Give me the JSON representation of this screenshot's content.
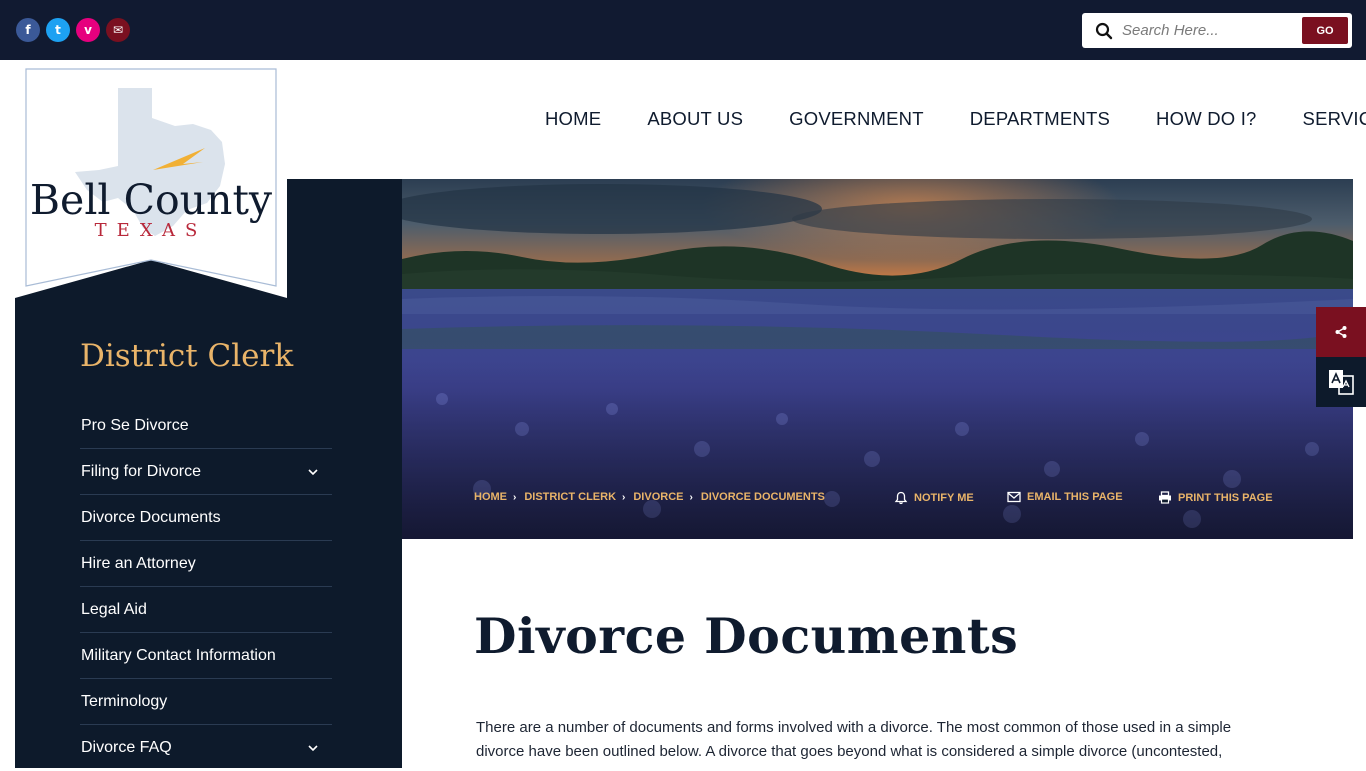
{
  "social": {
    "items": [
      {
        "icon": "facebook-icon",
        "glyph": "f",
        "color": "#3b5998"
      },
      {
        "icon": "twitter-icon",
        "glyph": "t",
        "color": "#1da1f2"
      },
      {
        "icon": "vimeo-icon",
        "glyph": "v",
        "color": "#e6007e"
      },
      {
        "icon": "email-icon",
        "glyph": "✉",
        "color": "#7a1020"
      }
    ]
  },
  "search": {
    "placeholder": "Search Here...",
    "go_label": "GO"
  },
  "logo": {
    "name_line1": "Bell County",
    "name_line2": "TEXAS"
  },
  "nav": {
    "items": [
      "HOME",
      "ABOUT US",
      "GOVERNMENT",
      "DEPARTMENTS",
      "HOW DO I?",
      "SERVICES"
    ]
  },
  "sidebar": {
    "title": "District Clerk",
    "items": [
      {
        "label": "Pro Se Divorce",
        "has_children": false
      },
      {
        "label": "Filing for Divorce",
        "has_children": true
      },
      {
        "label": "Divorce Documents",
        "has_children": false
      },
      {
        "label": "Hire an Attorney",
        "has_children": false
      },
      {
        "label": "Legal Aid",
        "has_children": false
      },
      {
        "label": "Military Contact Information",
        "has_children": false
      },
      {
        "label": "Terminology",
        "has_children": false
      },
      {
        "label": "Divorce FAQ",
        "has_children": true
      }
    ]
  },
  "breadcrumb": {
    "items": [
      "HOME",
      "DISTRICT CLERK",
      "DIVORCE",
      "DIVORCE DOCUMENTS"
    ]
  },
  "tools": {
    "notify": "NOTIFY ME",
    "email": "EMAIL THIS PAGE",
    "print": "PRINT THIS PAGE"
  },
  "main": {
    "title": "Divorce Documents",
    "intro": "There are a number of documents and forms involved with a divorce. The most common of those used in a simple divorce have been outlined below. A divorce that goes beyond what is considered a simple divorce (uncontested,"
  },
  "colors": {
    "navy": "#111a31",
    "maroon": "#7a1020",
    "gold": "#e9b469"
  }
}
